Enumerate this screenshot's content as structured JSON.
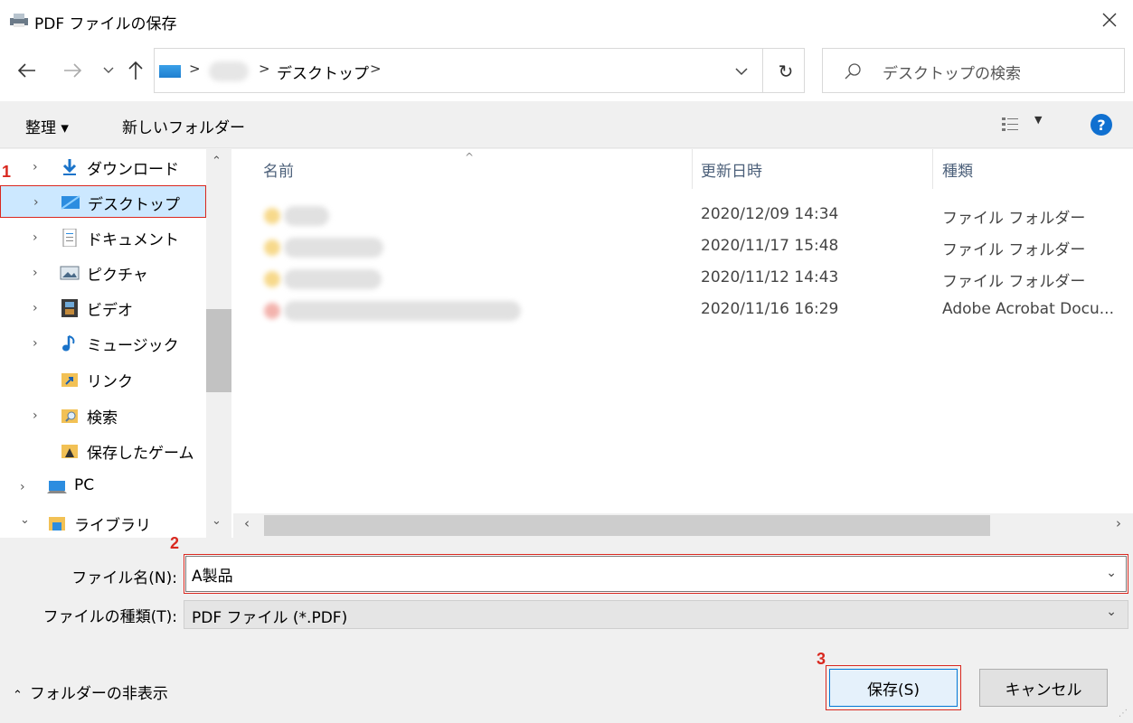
{
  "window": {
    "title": "PDF ファイルの保存",
    "close_icon": "close-icon"
  },
  "address": {
    "crumb": "デスクトップ",
    "separator": ">",
    "search_placeholder": "デスクトップの検索"
  },
  "toolbar": {
    "organize": "整理 ▾",
    "new_folder": "新しいフォルダー"
  },
  "nav": {
    "items": [
      {
        "label": "ダウンロード",
        "icon": "download-icon",
        "expandable": true
      },
      {
        "label": "デスクトップ",
        "icon": "desktop-icon",
        "expandable": true,
        "selected": true
      },
      {
        "label": "ドキュメント",
        "icon": "document-icon",
        "expandable": true
      },
      {
        "label": "ピクチャ",
        "icon": "pictures-icon",
        "expandable": true
      },
      {
        "label": "ビデオ",
        "icon": "video-icon",
        "expandable": true
      },
      {
        "label": "ミュージック",
        "icon": "music-icon",
        "expandable": true
      },
      {
        "label": "リンク",
        "icon": "links-icon",
        "expandable": false
      },
      {
        "label": "検索",
        "icon": "search-folder-icon",
        "expandable": true
      },
      {
        "label": "保存したゲーム",
        "icon": "saved-games-icon",
        "expandable": false
      },
      {
        "label": "PC",
        "icon": "pc-icon",
        "expandable": true
      },
      {
        "label": "ライブラリ",
        "icon": "library-icon",
        "expandable": true,
        "expanded": true
      }
    ]
  },
  "list": {
    "columns": [
      "名前",
      "更新日時",
      "種類"
    ],
    "rows": [
      {
        "date": "2020/12/09 14:34",
        "type": "ファイル フォルダー",
        "kind": "folder"
      },
      {
        "date": "2020/11/17 15:48",
        "type": "ファイル フォルダー",
        "kind": "folder"
      },
      {
        "date": "2020/11/12 14:43",
        "type": "ファイル フォルダー",
        "kind": "folder"
      },
      {
        "date": "2020/11/16 16:29",
        "type": "Adobe Acrobat Docu...",
        "kind": "pdf"
      }
    ]
  },
  "form": {
    "filename_label": "ファイル名(N):",
    "filename_value": "A製品",
    "filetype_label": "ファイルの種類(T):",
    "filetype_value": "PDF ファイル (*.PDF)"
  },
  "footer": {
    "hide_folders": "フォルダーの非表示",
    "save": "保存(S)",
    "cancel": "キャンセル"
  },
  "annotations": {
    "step1": "1",
    "step2": "2",
    "step3": "3"
  },
  "colors": {
    "accent": "#0078d7",
    "highlight": "#d9281f",
    "selected_bg": "#cce8ff"
  }
}
